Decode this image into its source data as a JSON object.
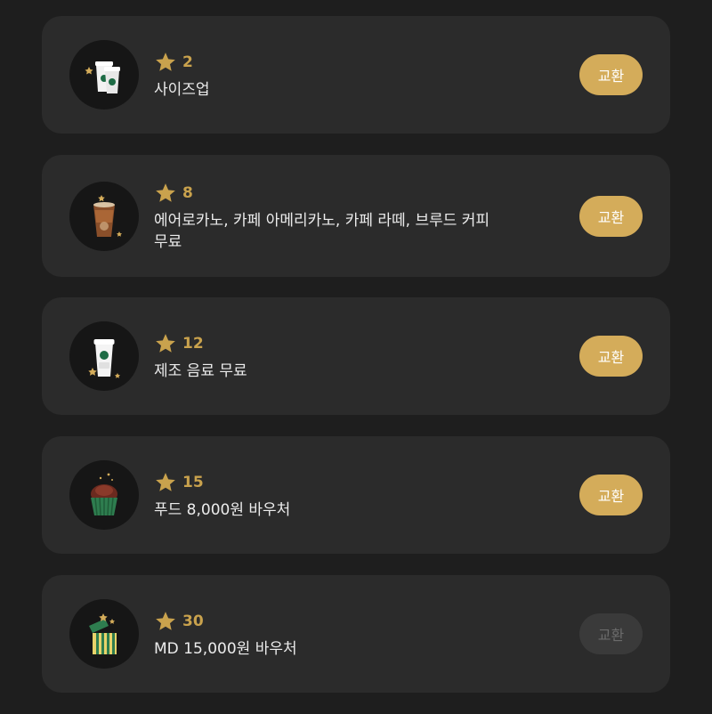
{
  "rewards": [
    {
      "stars": "2",
      "title": "사이즈업",
      "button": "교환",
      "enabled": true,
      "icon": "size-up-cups-icon"
    },
    {
      "stars": "8",
      "title": "에어로카노, 카페 아메리카노, 카페 라떼, 브루드 커피 무료",
      "button": "교환",
      "enabled": true,
      "icon": "iced-coffee-icon"
    },
    {
      "stars": "12",
      "title": "제조 음료 무료",
      "button": "교환",
      "enabled": true,
      "icon": "drink-cup-icon"
    },
    {
      "stars": "15",
      "title": "푸드 8,000원 바우처",
      "button": "교환",
      "enabled": true,
      "icon": "cupcake-icon"
    },
    {
      "stars": "30",
      "title": "MD 15,000원 바우처",
      "button": "교환",
      "enabled": false,
      "icon": "gift-box-icon"
    }
  ],
  "colors": {
    "background": "#1e1e1e",
    "card": "#2b2b2b",
    "accent_gold": "#d4ac5a",
    "star_gold": "#c9a24d",
    "disabled_button": "#3a3a3a"
  }
}
